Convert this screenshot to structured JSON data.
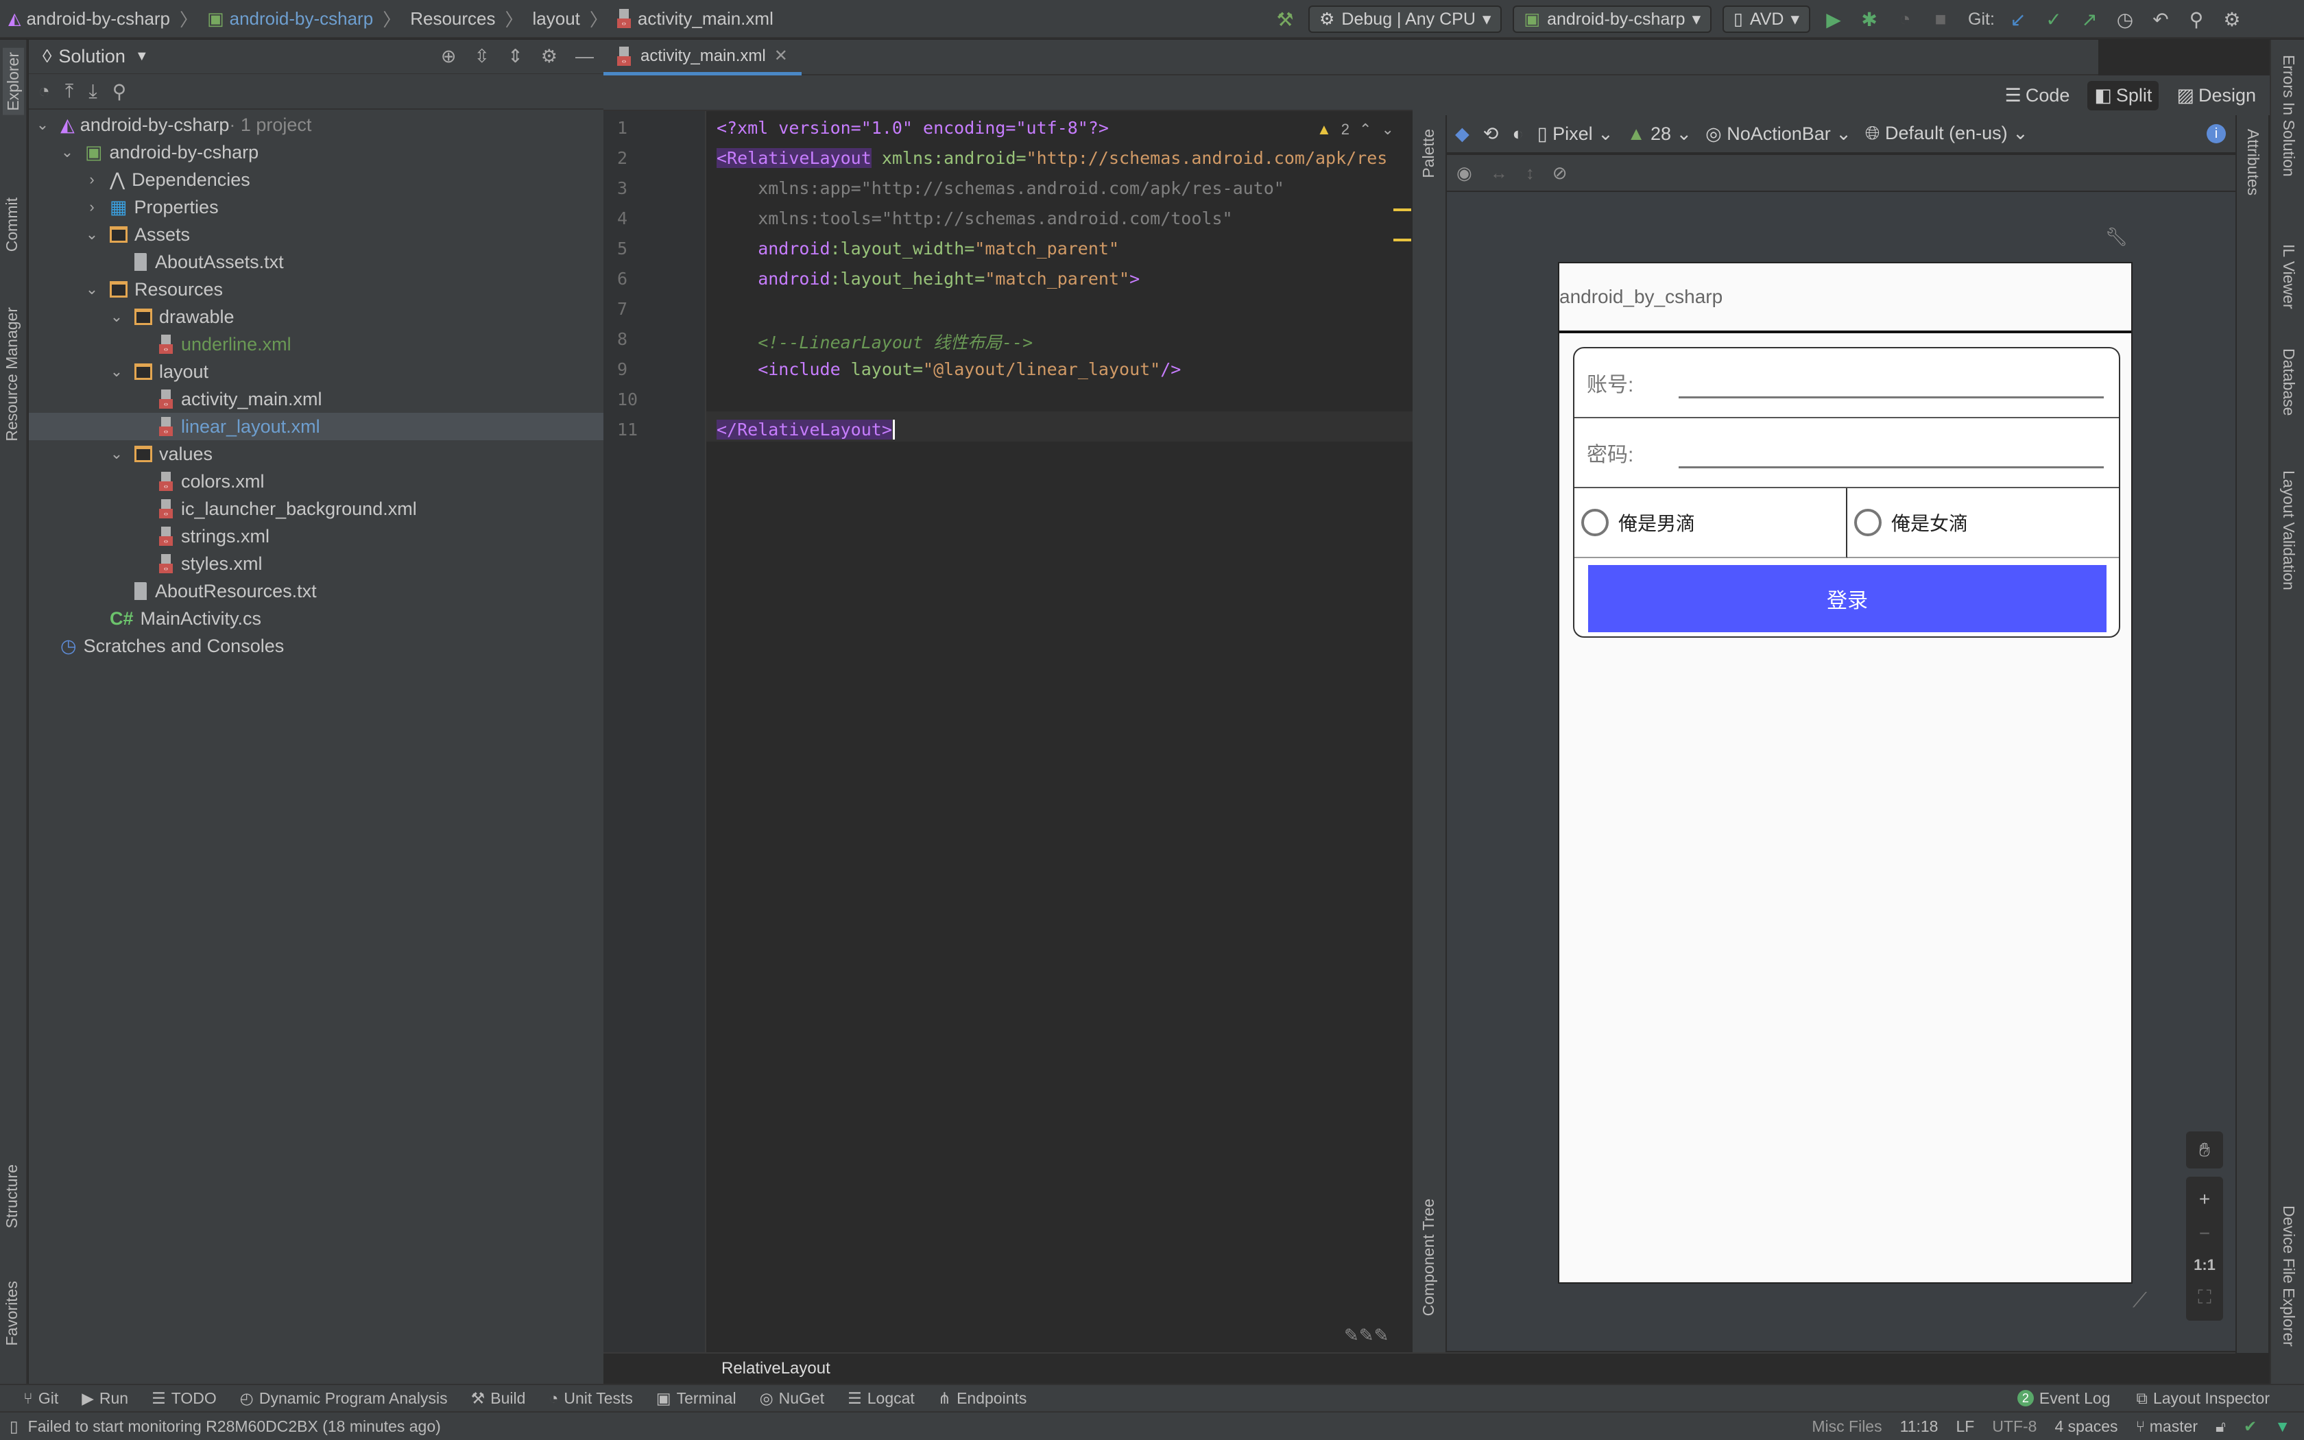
{
  "breadcrumb": {
    "items": [
      "android-by-csharp",
      "android-by-csharp",
      "Resources",
      "layout",
      "activity_main.xml"
    ]
  },
  "toolbar": {
    "config": "Debug | Any CPU",
    "project": "android-by-csharp",
    "device": "AVD",
    "git_label": "Git:"
  },
  "explorer": {
    "title": "Solution",
    "tree": [
      {
        "label": "android-by-csharp",
        "suffix": " · 1 project",
        "depth": 0,
        "type": "solution",
        "expanded": true
      },
      {
        "label": "android-by-csharp",
        "depth": 1,
        "type": "project",
        "expanded": true
      },
      {
        "label": "Dependencies",
        "depth": 2,
        "type": "deps",
        "expanded": false
      },
      {
        "label": "Properties",
        "depth": 2,
        "type": "props",
        "expanded": false
      },
      {
        "label": "Assets",
        "depth": 2,
        "type": "folder",
        "expanded": true
      },
      {
        "label": "AboutAssets.txt",
        "depth": 3,
        "type": "txt"
      },
      {
        "label": "Resources",
        "depth": 2,
        "type": "folder",
        "expanded": true
      },
      {
        "label": "drawable",
        "depth": 3,
        "type": "folder",
        "expanded": true
      },
      {
        "label": "underline.xml",
        "depth": 4,
        "type": "xml",
        "color": "#6a9955"
      },
      {
        "label": "layout",
        "depth": 3,
        "type": "folder",
        "expanded": true
      },
      {
        "label": "activity_main.xml",
        "depth": 4,
        "type": "xml"
      },
      {
        "label": "linear_layout.xml",
        "depth": 4,
        "type": "xml",
        "selected": true,
        "color": "#6e9fd0"
      },
      {
        "label": "values",
        "depth": 3,
        "type": "folder",
        "expanded": true
      },
      {
        "label": "colors.xml",
        "depth": 4,
        "type": "xml"
      },
      {
        "label": "ic_launcher_background.xml",
        "depth": 4,
        "type": "xml"
      },
      {
        "label": "strings.xml",
        "depth": 4,
        "type": "xml"
      },
      {
        "label": "styles.xml",
        "depth": 4,
        "type": "xml"
      },
      {
        "label": "AboutResources.txt",
        "depth": 3,
        "type": "txt"
      },
      {
        "label": "MainActivity.cs",
        "depth": 2,
        "type": "cs"
      },
      {
        "label": "Scratches and Consoles",
        "depth": 0,
        "type": "scratch"
      }
    ]
  },
  "left_tabs": [
    "Explorer",
    "Commit",
    "Resource Manager",
    "Structure",
    "Favorites"
  ],
  "editor": {
    "tab": "activity_main.xml",
    "warnings": "2",
    "lines": [
      "1",
      "2",
      "3",
      "4",
      "5",
      "6",
      "7",
      "8",
      "9",
      "10",
      "11"
    ],
    "code": {
      "l1": "<?xml version=\"1.0\" encoding=\"utf-8\"?>",
      "l2_tag": "<RelativeLayout",
      "l2_attr": " xmlns:android=",
      "l2_val": "\"http://schemas.android.com/apk/res",
      "l3": "    xmlns:app=\"http://schemas.android.com/apk/res-auto\"",
      "l4": "    xmlns:tools=\"http://schemas.android.com/tools\"",
      "l5_ns": "    android",
      "l5_attr": ":layout_width=",
      "l5_val": "\"match_parent\"",
      "l6_ns": "    android",
      "l6_attr": ":layout_height=",
      "l6_val": "\"match_parent\"",
      "l6_end": ">",
      "l8": "    <!--LinearLayout 线性布局-->",
      "l9_tag": "    <include",
      "l9_attr": " layout=",
      "l9_val": "\"@layout/linear_layout\"",
      "l9_end": "/>",
      "l11": "</RelativeLayout>"
    },
    "footer_breadcrumb": "RelativeLayout"
  },
  "view_modes": {
    "code": "Code",
    "split": "Split",
    "design": "Design",
    "active": "split"
  },
  "design_toolbar": {
    "device": "Pixel",
    "api": "28",
    "theme": "NoActionBar",
    "locale": "Default (en-us)"
  },
  "preview": {
    "app_title": "android_by_csharp",
    "account_label": "账号:",
    "password_label": "密码:",
    "radio_male": "俺是男滴",
    "radio_female": "俺是女滴",
    "login_button": "登录",
    "button_color": "#5058ff"
  },
  "zoom_controls": {
    "one_to_one": "1:1"
  },
  "side_panels": {
    "palette": "Palette",
    "component_tree": "Component Tree",
    "attributes": "Attributes",
    "right": [
      "Errors In Solution",
      "IL Viewer",
      "Database",
      "Layout Validation",
      "Device File Explorer"
    ]
  },
  "tool_windows": [
    "Git",
    "Run",
    "TODO",
    "Dynamic Program Analysis",
    "Build",
    "Unit Tests",
    "Terminal",
    "NuGet",
    "Logcat",
    "Endpoints"
  ],
  "tool_windows_right": {
    "event_log_count": "2",
    "event_log": "Event Log",
    "layout_inspector": "Layout Inspector"
  },
  "status": {
    "message": "Failed to start monitoring R28M60DC2BX (18 minutes ago)",
    "context": "Misc Files",
    "position": "11:18",
    "line_sep": "LF",
    "encoding": "UTF-8",
    "indent": "4 spaces",
    "branch": "master"
  }
}
